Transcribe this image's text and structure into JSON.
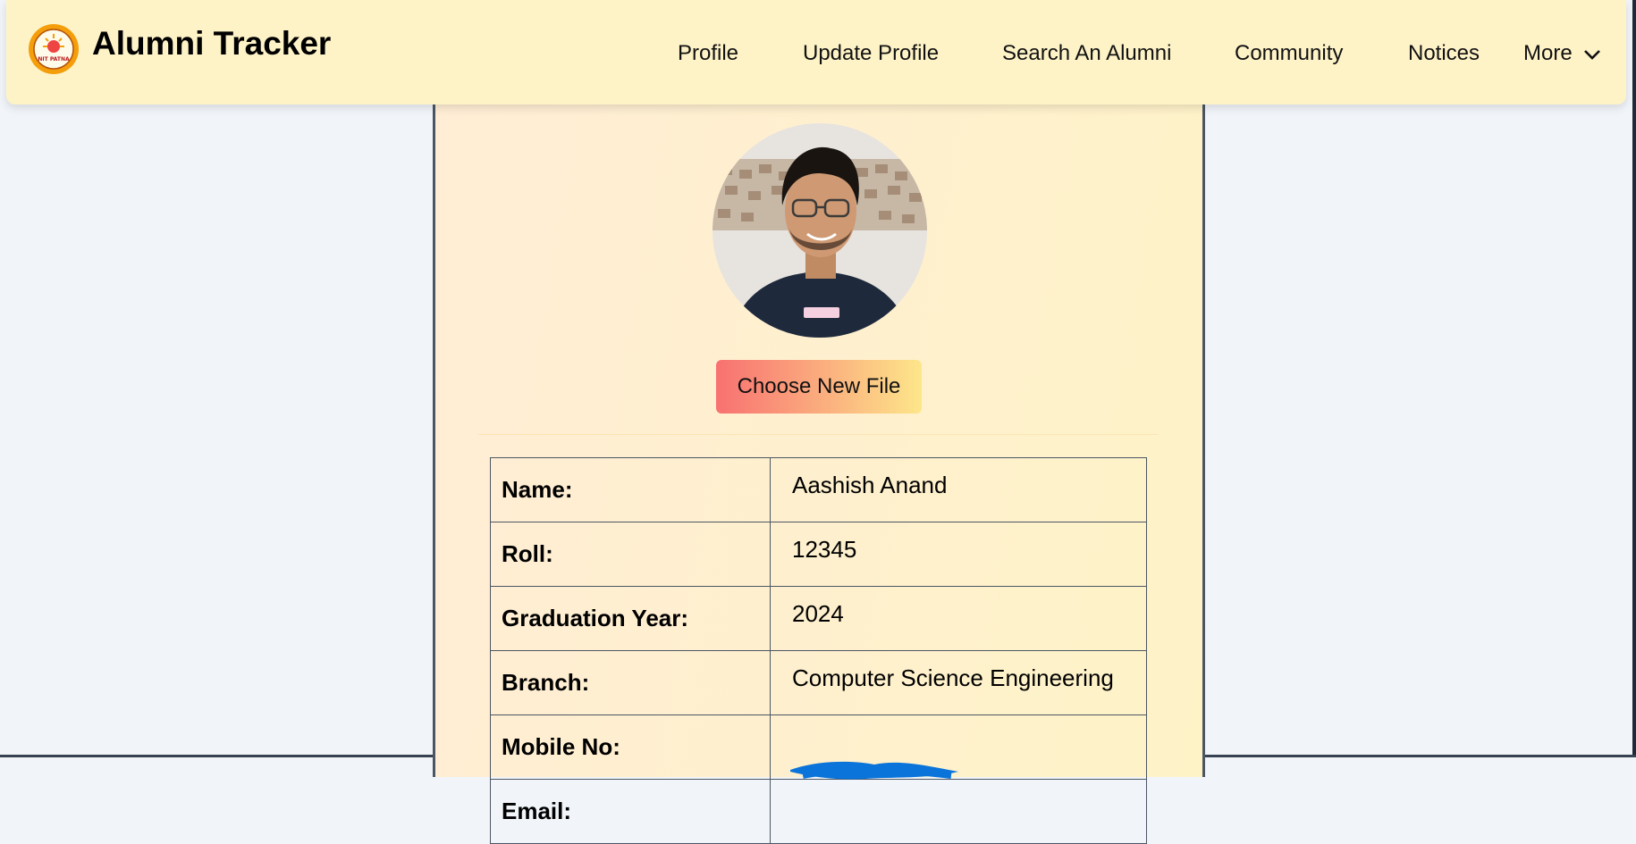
{
  "header": {
    "brand": "Alumni Tracker",
    "logo_text": "NIT PATNA",
    "nav": {
      "profile": "Profile",
      "update_profile": "Update Profile",
      "search_alumni": "Search An Alumni",
      "community": "Community",
      "notices": "Notices",
      "more": "More"
    }
  },
  "profile": {
    "choose_file_label": "Choose New File",
    "fields": [
      {
        "label": "Name:",
        "value": "Aashish Anand"
      },
      {
        "label": "Roll:",
        "value": "12345"
      },
      {
        "label": "Graduation Year:",
        "value": "2024"
      },
      {
        "label": "Branch:",
        "value": "Computer Science Engineering"
      },
      {
        "label": "Mobile No:",
        "value": ""
      },
      {
        "label": "Email:",
        "value": ""
      }
    ]
  },
  "colors": {
    "header_bg": "#fef3c7",
    "page_bg": "#f1f5f9",
    "redaction": "#0a74da",
    "button_start": "#f87171",
    "button_end": "#fde68a"
  }
}
